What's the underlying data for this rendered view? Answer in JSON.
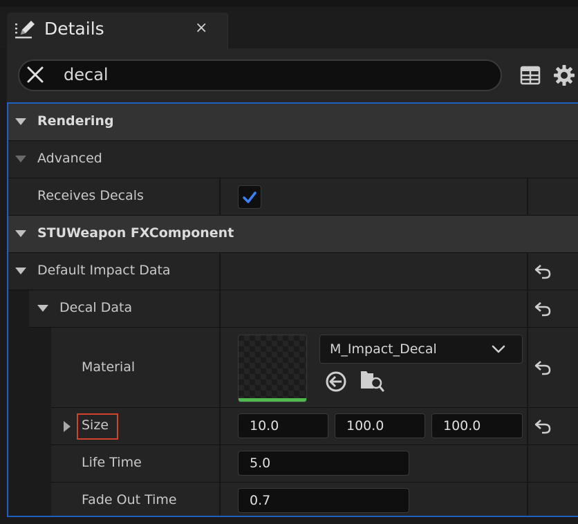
{
  "tab": {
    "title": "Details",
    "close_label": "×"
  },
  "search": {
    "value": "decal",
    "placeholder": ""
  },
  "icons": {
    "tab": "pencil-edit-icon",
    "clear": "close-x-icon",
    "table": "table-view-icon",
    "settings": "gear-icon",
    "reset": "reset-arrow-icon",
    "browse": "browse-arrow-icon",
    "find": "folder-search-icon",
    "chevron": "chevron-down-icon",
    "check": "checkmark-icon"
  },
  "colors": {
    "selection_border": "#1f5fbf",
    "check": "#3b82f6",
    "material_bar": "#4fb84f",
    "highlight": "#d0442c"
  },
  "rows": {
    "rendering": "Rendering",
    "advanced": "Advanced",
    "receives_decals": {
      "label": "Receives Decals",
      "checked": true
    },
    "stu_weapon": "STUWeapon FXComponent",
    "default_impact_data": "Default Impact Data",
    "decal_data": "Decal Data",
    "material": {
      "label": "Material",
      "value": "M_Impact_Decal"
    },
    "size": {
      "label": "Size",
      "x": "10.0",
      "y": "100.0",
      "z": "100.0"
    },
    "life_time": {
      "label": "Life Time",
      "value": "5.0"
    },
    "fade_out_time": {
      "label": "Fade Out Time",
      "value": "0.7"
    }
  }
}
